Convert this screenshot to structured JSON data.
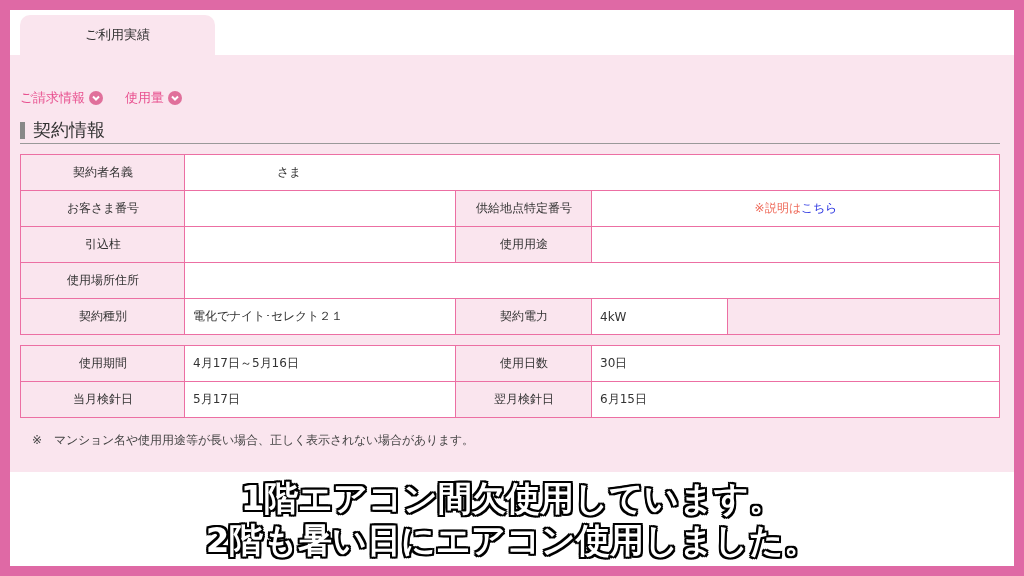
{
  "tabs": [
    {
      "label": "ご利用実績",
      "selected": true
    }
  ],
  "links": [
    {
      "label": "ご請求情報"
    },
    {
      "label": "使用量"
    }
  ],
  "section_title": "契約情報",
  "tables": [
    {
      "rows": [
        [
          {
            "kind": "label",
            "text": "契約者名義"
          },
          {
            "kind": "value",
            "text": "　　　　　　　さま",
            "colspan": 4
          }
        ],
        [
          {
            "kind": "label",
            "text": "お客さま番号"
          },
          {
            "kind": "value"
          },
          {
            "kind": "label",
            "text": "供給地点特定番号"
          },
          {
            "kind": "note",
            "text": "※説明は",
            "link": "こちら",
            "colspan": 2
          }
        ],
        [
          {
            "kind": "label",
            "text": "引込柱"
          },
          {
            "kind": "value"
          },
          {
            "kind": "label",
            "text": "使用用途"
          },
          {
            "kind": "value",
            "colspan": 2
          }
        ],
        [
          {
            "kind": "label",
            "text": "使用場所住所"
          },
          {
            "kind": "value",
            "colspan": 4
          }
        ],
        [
          {
            "kind": "label",
            "text": "契約種別"
          },
          {
            "kind": "value",
            "text": "電化でナイト･セレクト２１"
          },
          {
            "kind": "label",
            "text": "契約電力"
          },
          {
            "kind": "value",
            "text": "4kW"
          },
          {
            "kind": "blank"
          }
        ]
      ]
    },
    {
      "rows": [
        [
          {
            "kind": "label",
            "text": "使用期間"
          },
          {
            "kind": "value",
            "text": "4月17日～5月16日"
          },
          {
            "kind": "label",
            "text": "使用日数"
          },
          {
            "kind": "value",
            "text": "30日",
            "colspan": 2
          }
        ],
        [
          {
            "kind": "label",
            "text": "当月検針日"
          },
          {
            "kind": "value",
            "text": "5月17日"
          },
          {
            "kind": "label",
            "text": "翌月検針日"
          },
          {
            "kind": "value",
            "text": "6月15日",
            "colspan": 2
          }
        ]
      ]
    }
  ],
  "note": "※　マンション名や使用用途等が長い場合、正しく表示されない場合があります。",
  "subtitles": [
    "1階エアコン間欠使用しています。",
    "2階も暑い日にエアコン使用しました。"
  ]
}
